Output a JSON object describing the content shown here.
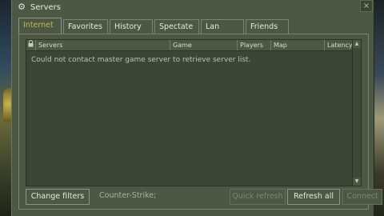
{
  "window": {
    "title": "Servers",
    "close": "×"
  },
  "tabs": [
    "Internet",
    "Favorites",
    "History",
    "Spectate",
    "Lan",
    "Friends"
  ],
  "active_tab": "Internet",
  "columns": [
    "Servers",
    "Game",
    "Players",
    "Map",
    "Latency"
  ],
  "message": "Could not contact master game server to retrieve server list.",
  "buttons": {
    "change_filters": "Change filters",
    "quick_refresh": "Quick refresh",
    "refresh_all": "Refresh all",
    "connect": "Connect"
  },
  "filter_text": "Counter-Strike;",
  "icons": {
    "app": "steam-icon",
    "lock": "lock-icon",
    "scroll_up": "▲",
    "scroll_down": "▼"
  },
  "colors": {
    "active_tab_text": "#c4b550",
    "window_bg": "#4c5844"
  }
}
